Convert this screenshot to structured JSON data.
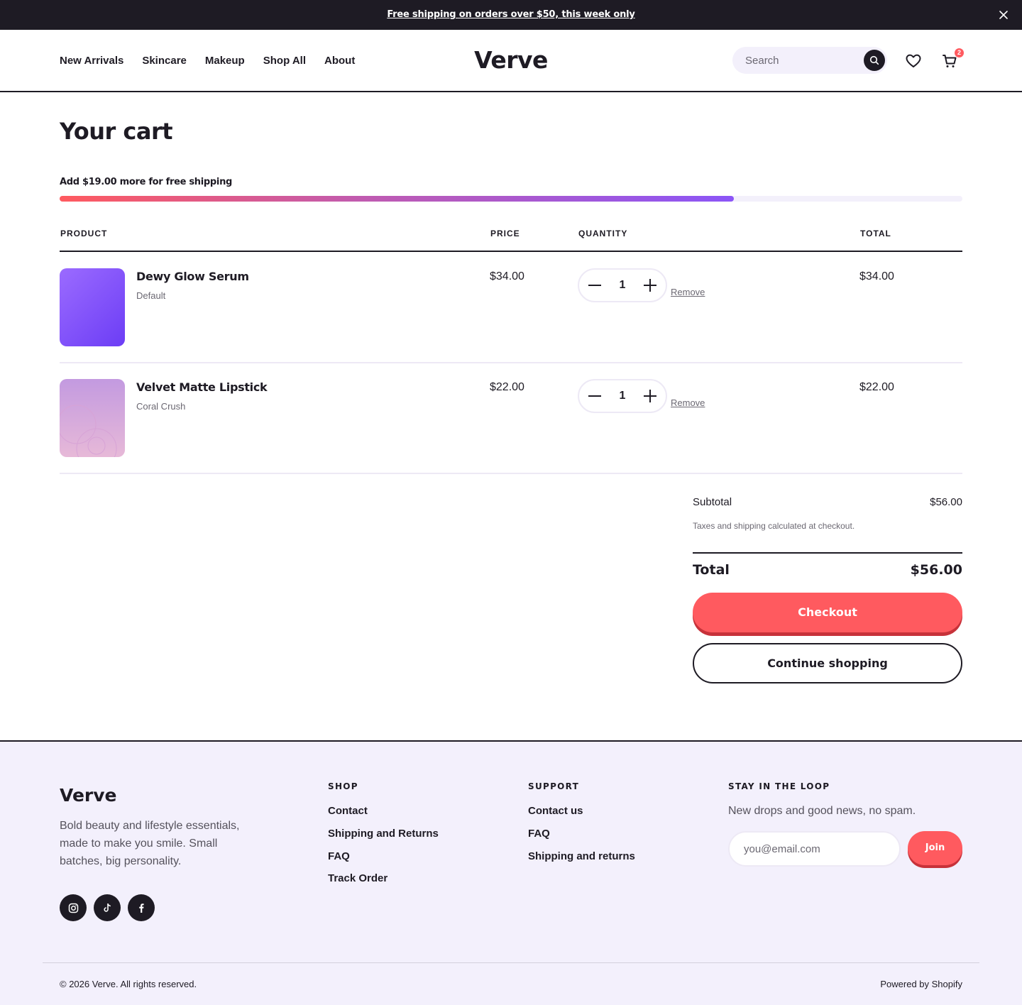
{
  "announcement": {
    "text": "Free shipping on orders over $50, this week only"
  },
  "header": {
    "nav": [
      "New Arrivals",
      "Skincare",
      "Makeup",
      "Shop All",
      "About"
    ],
    "logo": "Verve",
    "search_placeholder": "Search",
    "cart_count": "2"
  },
  "cart": {
    "title": "Your cart",
    "shipping_message": "Add $19.00 more for free shipping",
    "shipping_progress_percent": 74.7,
    "columns": {
      "product": "PRODUCT",
      "price": "PRICE",
      "quantity": "QUANTITY",
      "total": "TOTAL"
    },
    "items": [
      {
        "name": "Dewy Glow Serum",
        "variant": "Default",
        "price": "$34.00",
        "quantity": "1",
        "remove": "Remove",
        "total": "$34.00"
      },
      {
        "name": "Velvet Matte Lipstick",
        "variant": "Coral Crush",
        "price": "$22.00",
        "quantity": "1",
        "remove": "Remove",
        "total": "$22.00"
      }
    ]
  },
  "summary": {
    "subtotal_label": "Subtotal",
    "subtotal": "$56.00",
    "note": "Taxes and shipping calculated at checkout.",
    "total_label": "Total",
    "total": "$56.00",
    "checkout": "Checkout",
    "continue": "Continue shopping"
  },
  "footer": {
    "logo": "Verve",
    "description": "Bold beauty and lifestyle essentials, made to make you smile. Small batches, big personality.",
    "social": [
      "instagram-icon",
      "tiktok-icon",
      "facebook-icon"
    ],
    "shop_heading": "SHOP",
    "shop_links": [
      "Contact",
      "Shipping and Returns",
      "FAQ",
      "Track Order"
    ],
    "support_heading": "SUPPORT",
    "support_links": [
      "Contact us",
      "FAQ",
      "Shipping and returns"
    ],
    "newsletter_heading": "STAY IN THE LOOP",
    "newsletter_text": "New drops and good news, no spam.",
    "email_placeholder": "you@email.com",
    "join": "Join",
    "copyright": "© 2026 Verve. All rights reserved.",
    "powered": "Powered by Shopify"
  },
  "colors": {
    "ink": "#1e1b24",
    "accent": "#ff5a5f",
    "accent_shadow": "#c7323a",
    "lavender": "#f3f0fb",
    "purple": "#8b55f7"
  }
}
